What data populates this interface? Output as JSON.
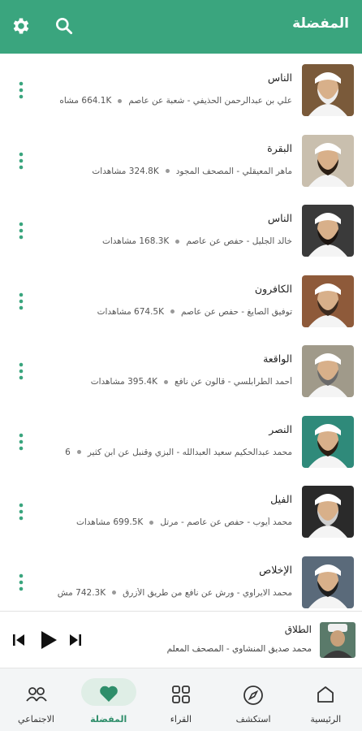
{
  "header": {
    "title": "المفضلة",
    "icons": [
      "settings-icon",
      "search-icon"
    ]
  },
  "accent_color": "#3aa57e",
  "items": [
    {
      "title": "الناس",
      "subtitle": "علي بن عبدالرحمن الحذيفي - شعبة عن عاصم",
      "views": "664.1K مشاه",
      "thumb_bg": "#7a5a3a",
      "hair": "#eeeeee"
    },
    {
      "title": "البقرة",
      "subtitle": "ماهر المعيقلي - المصحف المجود",
      "views": "324.8K مشاهدات",
      "thumb_bg": "#c9bfae",
      "hair": "#2a1e14"
    },
    {
      "title": "الناس",
      "subtitle": "خالد الجليل - حفص عن عاصم",
      "views": "168.3K مشاهدات",
      "thumb_bg": "#3a3a3a",
      "hair": "#1b1410"
    },
    {
      "title": "الكافرون",
      "subtitle": "توفيق الصايغ - حفص عن عاصم",
      "views": "674.5K مشاهدات",
      "thumb_bg": "#8e5a3a",
      "hair": "#3b2a1e"
    },
    {
      "title": "الواقعة",
      "subtitle": "أحمد الطرابلسي - قالون عن نافع",
      "views": "395.4K مشاهدات",
      "thumb_bg": "#a09a8a",
      "hair": "#6a6a6a"
    },
    {
      "title": "النصر",
      "subtitle": "محمد عبدالحكيم سعيد العبدالله - البزي وقنبل عن ابن كثير",
      "views": "6",
      "thumb_bg": "#2f8a7a",
      "hair": "#2a1e14"
    },
    {
      "title": "الفيل",
      "subtitle": "محمد أيوب - حفص عن عاصم - مرتل",
      "views": "699.5K مشاهدات",
      "thumb_bg": "#2a2a2a",
      "hair": "#cfcfcf"
    },
    {
      "title": "الإخلاص",
      "subtitle": "محمد الايراوي - ورش عن نافع من طريق الأزرق",
      "views": "742.3K مش",
      "thumb_bg": "#5a6a7a",
      "hair": "#1e1e1e"
    }
  ],
  "player": {
    "title": "الطلاق",
    "subtitle": "محمد صديق المنشاوي - المصحف المعلم",
    "controls": [
      "skip-previous-icon",
      "play-icon",
      "skip-next-icon"
    ]
  },
  "nav": [
    {
      "label": "الاجتماعي",
      "icon": "people-icon",
      "active": false
    },
    {
      "label": "المفضلة",
      "icon": "heart-icon",
      "active": true
    },
    {
      "label": "القراء",
      "icon": "grid-icon",
      "active": false
    },
    {
      "label": "استكشف",
      "icon": "compass-icon",
      "active": false
    },
    {
      "label": "الرئيسية",
      "icon": "home-icon",
      "active": false
    }
  ]
}
